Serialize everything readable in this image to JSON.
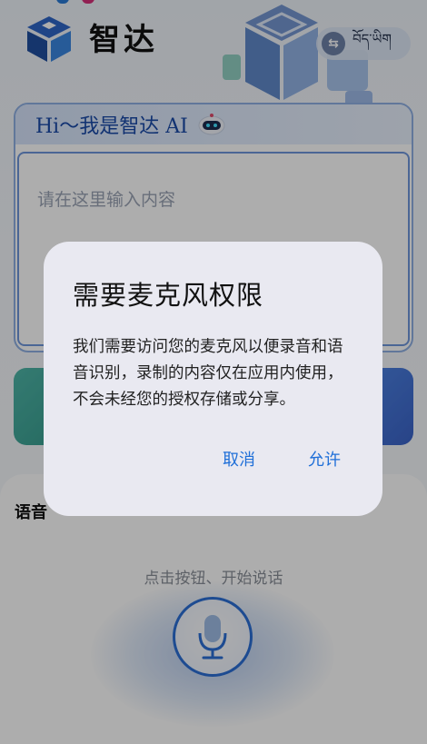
{
  "app": {
    "brand": "智达",
    "language_label": "བོད་ཡིག",
    "language_icon": "swap-icon"
  },
  "chat": {
    "title": "Hi～我是智达 AI",
    "placeholder": "请在这里输入内容"
  },
  "voice": {
    "title": "语音",
    "hint": "点击按钮、开始说话",
    "mic_icon": "microphone-icon"
  },
  "dialog": {
    "title": "需要麦克风权限",
    "message": "我们需要访问您的麦克风以便录音和语音识别，录制的内容仅在应用内使用，不会未经您的授权存储或分享。",
    "cancel_label": "取消",
    "allow_label": "允许"
  },
  "colors": {
    "accent": "#1f6fd8",
    "dialog_bg": "#e9e9f1",
    "scrim": "rgba(0,0,0,0.32)",
    "brand_blue": "#1a4aa8"
  }
}
